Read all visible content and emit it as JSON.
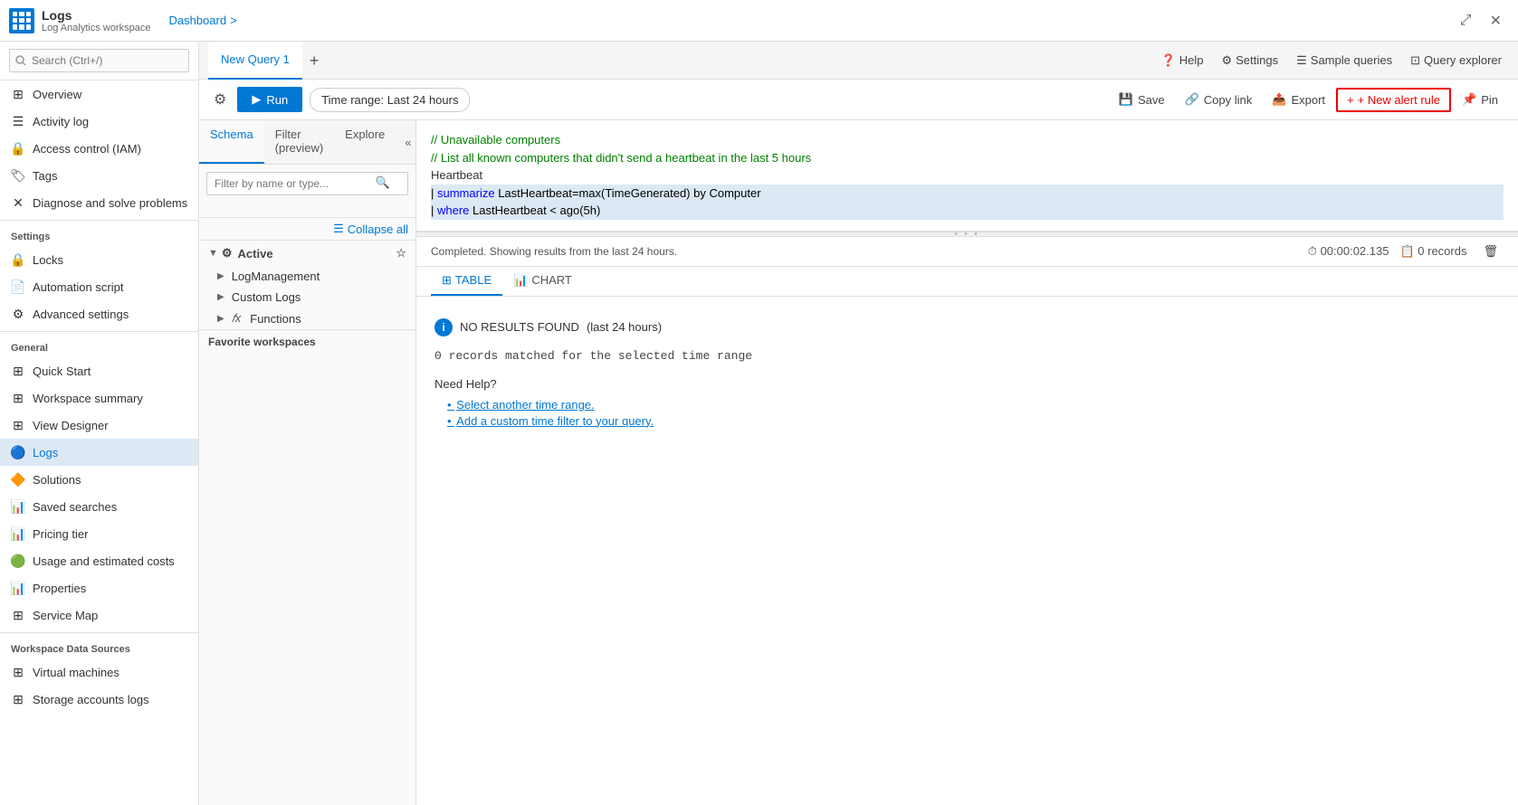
{
  "topbar": {
    "logo_title": "Logs",
    "logo_subtitle": "Log Analytics workspace",
    "breadcrumb": "Dashboard",
    "breadcrumb_sep": ">",
    "minimize_icon": "⊟",
    "close_icon": "✕",
    "toolbar": {
      "help": "Help",
      "settings": "Settings",
      "sample_queries": "Sample queries",
      "query_explorer": "Query explorer"
    }
  },
  "sidebar": {
    "search_placeholder": "Search (Ctrl+/)",
    "items": [
      {
        "id": "overview",
        "label": "Overview",
        "icon": "⊞",
        "active": false
      },
      {
        "id": "activity-log",
        "label": "Activity log",
        "icon": "📋",
        "active": false
      },
      {
        "id": "access-control",
        "label": "Access control (IAM)",
        "icon": "🔒",
        "active": false
      },
      {
        "id": "tags",
        "label": "Tags",
        "icon": "🏷",
        "active": false
      },
      {
        "id": "diagnose",
        "label": "Diagnose and solve problems",
        "icon": "✕",
        "active": false
      }
    ],
    "settings_section": "Settings",
    "settings_items": [
      {
        "id": "locks",
        "label": "Locks",
        "icon": "🔒",
        "active": false
      },
      {
        "id": "automation",
        "label": "Automation script",
        "icon": "📄",
        "active": false
      },
      {
        "id": "advanced-settings",
        "label": "Advanced settings",
        "icon": "⚙",
        "active": false
      }
    ],
    "general_section": "General",
    "general_items": [
      {
        "id": "quick-start",
        "label": "Quick Start",
        "icon": "⊞",
        "active": false
      },
      {
        "id": "workspace-summary",
        "label": "Workspace summary",
        "icon": "⊞",
        "active": false
      },
      {
        "id": "view-designer",
        "label": "View Designer",
        "icon": "⊞",
        "active": false
      },
      {
        "id": "logs",
        "label": "Logs",
        "icon": "🔵",
        "active": true
      },
      {
        "id": "solutions",
        "label": "Solutions",
        "icon": "🔶",
        "active": false
      },
      {
        "id": "saved-searches",
        "label": "Saved searches",
        "icon": "📊",
        "active": false
      },
      {
        "id": "pricing-tier",
        "label": "Pricing tier",
        "icon": "📊",
        "active": false
      },
      {
        "id": "usage-costs",
        "label": "Usage and estimated costs",
        "icon": "🟢",
        "active": false
      },
      {
        "id": "properties",
        "label": "Properties",
        "icon": "📊",
        "active": false
      },
      {
        "id": "service-map",
        "label": "Service Map",
        "icon": "⊞",
        "active": false
      }
    ],
    "workspace_data_section": "Workspace Data Sources",
    "workspace_data_items": [
      {
        "id": "virtual-machines",
        "label": "Virtual machines",
        "icon": "⊞",
        "active": false
      },
      {
        "id": "storage-accounts",
        "label": "Storage accounts logs",
        "icon": "⊞",
        "active": false
      }
    ]
  },
  "query_tabs": {
    "tabs": [
      {
        "id": "new-query-1",
        "label": "New Query 1",
        "active": true
      }
    ],
    "add_label": "+",
    "help": "Help",
    "settings": "Settings",
    "sample_queries": "Sample queries",
    "query_explorer": "Query explorer"
  },
  "query_toolbar": {
    "run_label": "Run",
    "time_range_label": "Time range: Last 24 hours",
    "save_label": "Save",
    "copy_link_label": "Copy link",
    "export_label": "Export",
    "new_alert_label": "+ New alert rule",
    "pin_label": "Pin"
  },
  "schema_panel": {
    "tab_schema": "Schema",
    "tab_filter": "Filter (preview)",
    "tab_explore": "Explore",
    "search_placeholder": "Filter by name or type...",
    "collapse_all": "Collapse all",
    "active_section": "Active",
    "tree_items": [
      {
        "id": "log-management",
        "label": "LogManagement",
        "expanded": false
      },
      {
        "id": "custom-logs",
        "label": "Custom Logs",
        "expanded": false
      },
      {
        "id": "functions",
        "label": "Functions",
        "expanded": false,
        "prefix": "𝑓x"
      }
    ],
    "favorite_workspaces": "Favorite workspaces"
  },
  "code_editor": {
    "lines": [
      {
        "type": "comment",
        "text": "// Unavailable computers"
      },
      {
        "type": "comment",
        "text": "// List all known computers that didn't send a heartbeat in the last 5 hours"
      },
      {
        "type": "default",
        "text": "Heartbeat"
      },
      {
        "type": "highlight",
        "text": "| summarize LastHeartbeat=max(TimeGenerated) by Computer"
      },
      {
        "type": "highlight",
        "text": "| where LastHeartbeat < ago(5h)"
      }
    ]
  },
  "results": {
    "status": "Completed. Showing results from the last 24 hours.",
    "time": "00:00:02.135",
    "records": "0 records",
    "tab_table": "TABLE",
    "tab_chart": "CHART",
    "no_results_title": "NO RESULTS FOUND",
    "no_results_range": "(last 24 hours)",
    "no_results_desc": "0 records matched for the selected time range",
    "need_help": "Need Help?",
    "help_links": [
      {
        "id": "select-time-range",
        "label": "Select another time range."
      },
      {
        "id": "add-time-filter",
        "label": "Add a custom time filter to your query."
      }
    ]
  }
}
